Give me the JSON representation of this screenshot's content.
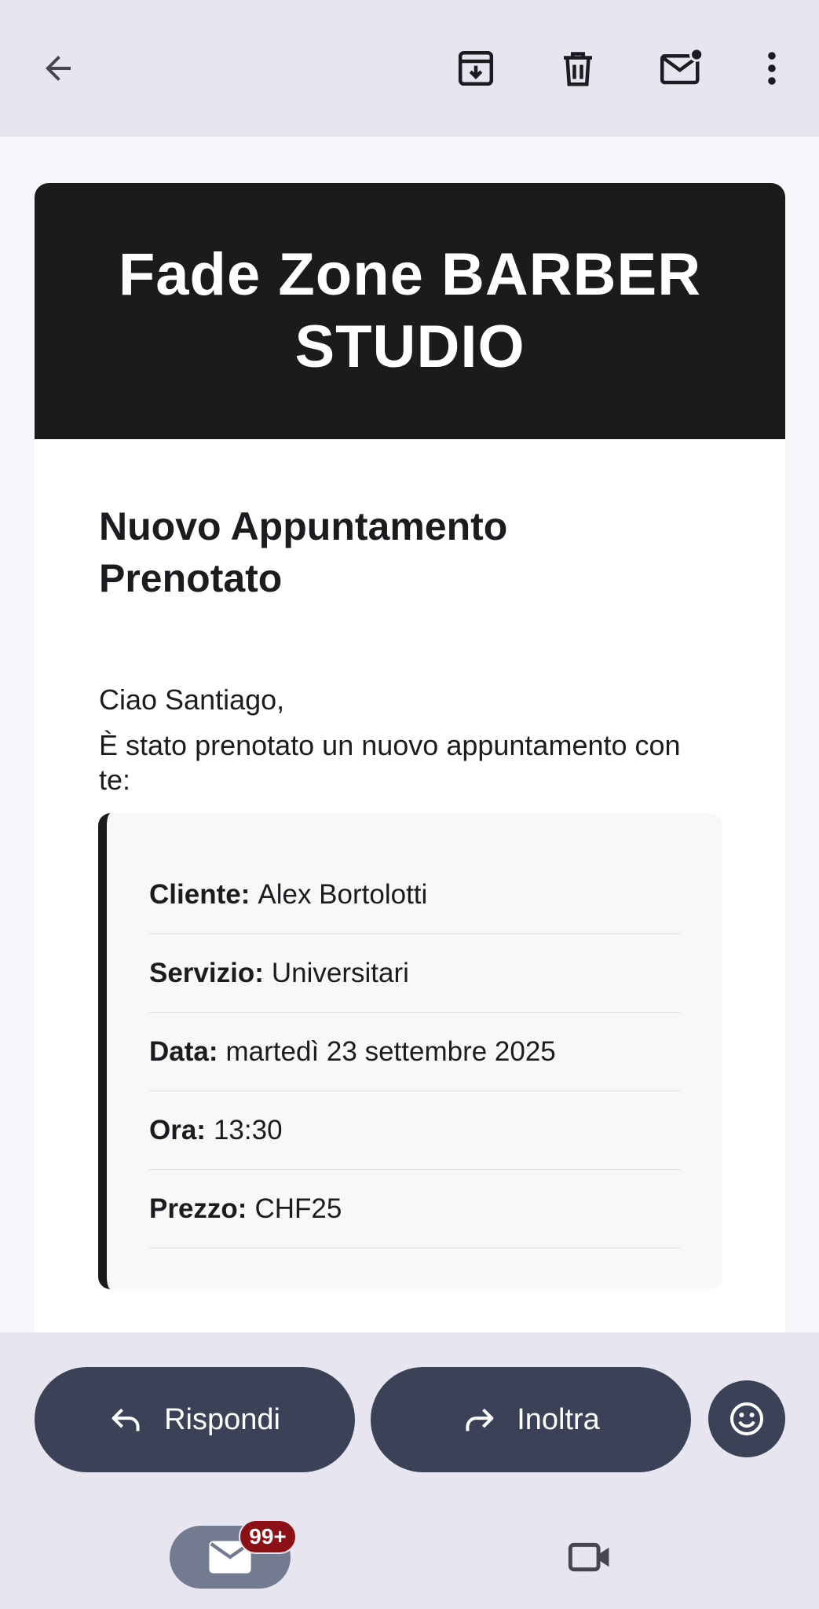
{
  "toolbar": {
    "back_icon": "arrow-left-icon",
    "archive_icon": "archive-icon",
    "delete_icon": "trash-icon",
    "mark_unread_icon": "mail-unread-icon",
    "more_icon": "more-vertical-icon"
  },
  "email": {
    "banner_title": "Fade Zone BARBER STUDIO",
    "headline": "Nuovo Appuntamento Prenotato",
    "greeting": "Ciao Santiago,",
    "intro": "È stato prenotato un nuovo appuntamento con te:",
    "details": [
      {
        "label": "Cliente:",
        "value": "Alex Bortolotti"
      },
      {
        "label": "Servizio:",
        "value": "Universitari"
      },
      {
        "label": "Data:",
        "value": "martedì 23 settembre 2025"
      },
      {
        "label": "Ora:",
        "value": "13:30"
      },
      {
        "label": "Prezzo:",
        "value": "CHF25"
      }
    ]
  },
  "actions": {
    "reply_label": "Rispondi",
    "forward_label": "Inoltra",
    "emoji_icon": "emoji-icon"
  },
  "nav": {
    "mail_badge": "99+",
    "mail_icon": "mail-icon",
    "meet_icon": "video-icon"
  },
  "colors": {
    "banner": "#1b1b1b",
    "pill": "#3b4257",
    "badge": "#8c1116",
    "bar": "#e6e5f0"
  }
}
